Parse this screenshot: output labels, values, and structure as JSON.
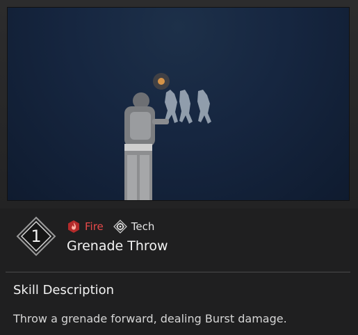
{
  "preview": {
    "icon": "skill-preview-video"
  },
  "skill": {
    "slot_number": "1",
    "tags": [
      {
        "label": "Fire",
        "icon": "fire-element-icon",
        "color": "#e84a4a"
      },
      {
        "label": "Tech",
        "icon": "tech-gear-icon",
        "color": "#e6e6e6"
      }
    ],
    "name": "Grenade Throw"
  },
  "description": {
    "heading": "Skill Description",
    "text": "Throw a grenade forward, dealing Burst damage."
  }
}
